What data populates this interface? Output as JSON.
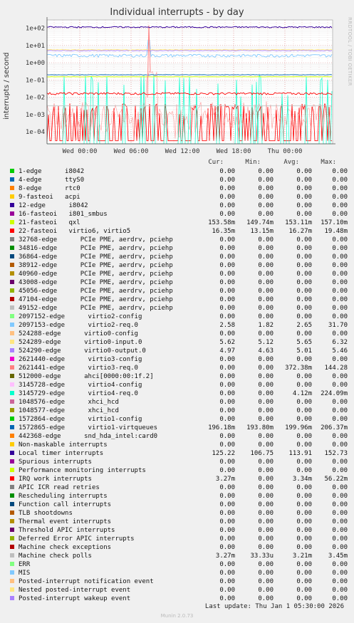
{
  "title": "Individual interrupts - by day",
  "side_text": "RRDTOOL / TOBI OETIKER",
  "ylabel": "interrupts / second",
  "headers": [
    "Cur:",
    "Min:",
    "Avg:",
    "Max:"
  ],
  "last_update": "Last update: Thu Jan  1 05:30:00 2026",
  "footer": "Munin 2.0.73",
  "chart_data": {
    "type": "line",
    "title": "Individual interrupts - by day",
    "ylabel": "interrupts / second",
    "y_scale": "log",
    "ylim": [
      2e-05,
      300
    ],
    "y_ticks": [
      "1e-04",
      "1e-03",
      "1e-02",
      "1e-01",
      "1e+00",
      "1e+01",
      "1e+02"
    ],
    "x_ticks": [
      "Wed 00:00",
      "Wed 06:00",
      "Wed 12:00",
      "Wed 18:00",
      "Thu 00:00"
    ],
    "grid": true,
    "series": [
      {
        "name": "1-edge      i8042",
        "color": "#00cc00",
        "cur": "0.00",
        "min": "0.00",
        "avg": "0.00",
        "max": "0.00"
      },
      {
        "name": "4-edge      ttyS0",
        "color": "#0066b3",
        "cur": "0.00",
        "min": "0.00",
        "avg": "0.00",
        "max": "0.00"
      },
      {
        "name": "8-edge      rtc0",
        "color": "#ff8000",
        "cur": "0.00",
        "min": "0.00",
        "avg": "0.00",
        "max": "0.00"
      },
      {
        "name": "9-fasteoi   acpi",
        "color": "#ffcc00",
        "cur": "0.00",
        "min": "0.00",
        "avg": "0.00",
        "max": "0.00"
      },
      {
        "name": "12-edge      i8042",
        "color": "#330099",
        "cur": "0.00",
        "min": "0.00",
        "avg": "0.00",
        "max": "0.00"
      },
      {
        "name": "16-fasteoi   i801_smbus",
        "color": "#990099",
        "cur": "0.00",
        "min": "0.00",
        "avg": "0.00",
        "max": "0.00"
      },
      {
        "name": "21-fasteoi   qxl",
        "color": "#ccff00",
        "cur": "153.58m",
        "min": "149.74m",
        "avg": "153.11m",
        "max": "157.10m"
      },
      {
        "name": "22-fasteoi   virtio6, virtio5",
        "color": "#ff0000",
        "cur": "16.35m",
        "min": "13.15m",
        "avg": "16.27m",
        "max": "19.48m"
      },
      {
        "name": "32768-edge      PCIe PME, aerdrv, pciehp",
        "color": "#808080",
        "cur": "0.00",
        "min": "0.00",
        "avg": "0.00",
        "max": "0.00"
      },
      {
        "name": "34816-edge      PCIe PME, aerdrv, pciehp",
        "color": "#008f00",
        "cur": "0.00",
        "min": "0.00",
        "avg": "0.00",
        "max": "0.00"
      },
      {
        "name": "36864-edge      PCIe PME, aerdrv, pciehp",
        "color": "#00487d",
        "cur": "0.00",
        "min": "0.00",
        "avg": "0.00",
        "max": "0.00"
      },
      {
        "name": "38912-edge      PCIe PME, aerdrv, pciehp",
        "color": "#b35a00",
        "cur": "0.00",
        "min": "0.00",
        "avg": "0.00",
        "max": "0.00"
      },
      {
        "name": "40960-edge      PCIe PME, aerdrv, pciehp",
        "color": "#b38f00",
        "cur": "0.00",
        "min": "0.00",
        "avg": "0.00",
        "max": "0.00"
      },
      {
        "name": "43008-edge      PCIe PME, aerdrv, pciehp",
        "color": "#6b006b",
        "cur": "0.00",
        "min": "0.00",
        "avg": "0.00",
        "max": "0.00"
      },
      {
        "name": "45056-edge      PCIe PME, aerdrv, pciehp",
        "color": "#8fb300",
        "cur": "0.00",
        "min": "0.00",
        "avg": "0.00",
        "max": "0.00"
      },
      {
        "name": "47104-edge      PCIe PME, aerdrv, pciehp",
        "color": "#b30000",
        "cur": "0.00",
        "min": "0.00",
        "avg": "0.00",
        "max": "0.00"
      },
      {
        "name": "49152-edge      PCIe PME, aerdrv, pciehp",
        "color": "#bebebe",
        "cur": "0.00",
        "min": "0.00",
        "avg": "0.00",
        "max": "0.00"
      },
      {
        "name": "2097152-edge      virtio2-config",
        "color": "#80ff80",
        "cur": "0.00",
        "min": "0.00",
        "avg": "0.00",
        "max": "0.00"
      },
      {
        "name": "2097153-edge      virtio2-req.0",
        "color": "#80c9ff",
        "cur": "2.58",
        "min": "1.82",
        "avg": "2.65",
        "max": "31.70"
      },
      {
        "name": "524288-edge      virtio0-config",
        "color": "#ffc080",
        "cur": "0.00",
        "min": "0.00",
        "avg": "0.00",
        "max": "0.00"
      },
      {
        "name": "524289-edge      virtio0-input.0",
        "color": "#ffe680",
        "cur": "5.62",
        "min": "5.12",
        "avg": "5.65",
        "max": "6.32"
      },
      {
        "name": "524290-edge      virtio0-output.0",
        "color": "#aa80ff",
        "cur": "4.97",
        "min": "4.63",
        "avg": "5.01",
        "max": "5.46"
      },
      {
        "name": "2621440-edge      virtio3-config",
        "color": "#ee00cc",
        "cur": "0.00",
        "min": "0.00",
        "avg": "0.00",
        "max": "0.00"
      },
      {
        "name": "2621441-edge      virtio3-req.0",
        "color": "#ff8080",
        "cur": "0.00",
        "min": "0.00",
        "avg": "372.38m",
        "max": "144.28"
      },
      {
        "name": "512000-edge      ahci[0000:00:1f.2]",
        "color": "#666600",
        "cur": "0.00",
        "min": "0.00",
        "avg": "0.00",
        "max": "0.00"
      },
      {
        "name": "3145728-edge      virtio4-config",
        "color": "#ffbfff",
        "cur": "0.00",
        "min": "0.00",
        "avg": "0.00",
        "max": "0.00"
      },
      {
        "name": "3145729-edge      virtio4-req.0",
        "color": "#00ffcc",
        "cur": "0.00",
        "min": "0.00",
        "avg": "4.12m",
        "max": "224.09m"
      },
      {
        "name": "1048576-edge      xhci_hcd",
        "color": "#cc6699",
        "cur": "0.00",
        "min": "0.00",
        "avg": "0.00",
        "max": "0.00"
      },
      {
        "name": "1048577-edge      xhci_hcd",
        "color": "#999900",
        "cur": "0.00",
        "min": "0.00",
        "avg": "0.00",
        "max": "0.00"
      },
      {
        "name": "1572864-edge      virtio1-config",
        "color": "#00cc00",
        "cur": "0.00",
        "min": "0.00",
        "avg": "0.00",
        "max": "0.00"
      },
      {
        "name": "1572865-edge      virtio1-virtqueues",
        "color": "#0066b3",
        "cur": "196.18m",
        "min": "193.80m",
        "avg": "199.96m",
        "max": "206.37m"
      },
      {
        "name": "442368-edge      snd_hda_intel:card0",
        "color": "#ff8000",
        "cur": "0.00",
        "min": "0.00",
        "avg": "0.00",
        "max": "0.00"
      },
      {
        "name": "Non-maskable interrupts",
        "color": "#ffcc00",
        "cur": "0.00",
        "min": "0.00",
        "avg": "0.00",
        "max": "0.00"
      },
      {
        "name": "Local timer interrupts",
        "color": "#330099",
        "cur": "125.22",
        "min": "106.75",
        "avg": "113.91",
        "max": "152.73"
      },
      {
        "name": "Spurious interrupts",
        "color": "#990099",
        "cur": "0.00",
        "min": "0.00",
        "avg": "0.00",
        "max": "0.00"
      },
      {
        "name": "Performance monitoring interrupts",
        "color": "#ccff00",
        "cur": "0.00",
        "min": "0.00",
        "avg": "0.00",
        "max": "0.00"
      },
      {
        "name": "IRQ work interrupts",
        "color": "#ff0000",
        "cur": "3.27m",
        "min": "0.00",
        "avg": "3.34m",
        "max": "56.22m"
      },
      {
        "name": "APIC ICR read retries",
        "color": "#808080",
        "cur": "0.00",
        "min": "0.00",
        "avg": "0.00",
        "max": "0.00"
      },
      {
        "name": "Rescheduling interrupts",
        "color": "#008f00",
        "cur": "0.00",
        "min": "0.00",
        "avg": "0.00",
        "max": "0.00"
      },
      {
        "name": "Function call interrupts",
        "color": "#00487d",
        "cur": "0.00",
        "min": "0.00",
        "avg": "0.00",
        "max": "0.00"
      },
      {
        "name": "TLB shootdowns",
        "color": "#b35a00",
        "cur": "0.00",
        "min": "0.00",
        "avg": "0.00",
        "max": "0.00"
      },
      {
        "name": "Thermal event interrupts",
        "color": "#b38f00",
        "cur": "0.00",
        "min": "0.00",
        "avg": "0.00",
        "max": "0.00"
      },
      {
        "name": "Threshold APIC interrupts",
        "color": "#6b006b",
        "cur": "0.00",
        "min": "0.00",
        "avg": "0.00",
        "max": "0.00"
      },
      {
        "name": "Deferred Error APIC interrupts",
        "color": "#8fb300",
        "cur": "0.00",
        "min": "0.00",
        "avg": "0.00",
        "max": "0.00"
      },
      {
        "name": "Machine check exceptions",
        "color": "#b30000",
        "cur": "0.00",
        "min": "0.00",
        "avg": "0.00",
        "max": "0.00"
      },
      {
        "name": "Machine check polls",
        "color": "#bebebe",
        "cur": "3.27m",
        "min": "33.33u",
        "avg": "3.21m",
        "max": "3.45m"
      },
      {
        "name": "ERR",
        "color": "#80ff80",
        "cur": "0.00",
        "min": "0.00",
        "avg": "0.00",
        "max": "0.00"
      },
      {
        "name": "MIS",
        "color": "#80c9ff",
        "cur": "0.00",
        "min": "0.00",
        "avg": "0.00",
        "max": "0.00"
      },
      {
        "name": "Posted-interrupt notification event",
        "color": "#ffc080",
        "cur": "0.00",
        "min": "0.00",
        "avg": "0.00",
        "max": "0.00"
      },
      {
        "name": "Nested posted-interrupt event",
        "color": "#ffe680",
        "cur": "0.00",
        "min": "0.00",
        "avg": "0.00",
        "max": "0.00"
      },
      {
        "name": "Posted-interrupt wakeup event",
        "color": "#aa80ff",
        "cur": "0.00",
        "min": "0.00",
        "avg": "0.00",
        "max": "0.00"
      }
    ]
  }
}
